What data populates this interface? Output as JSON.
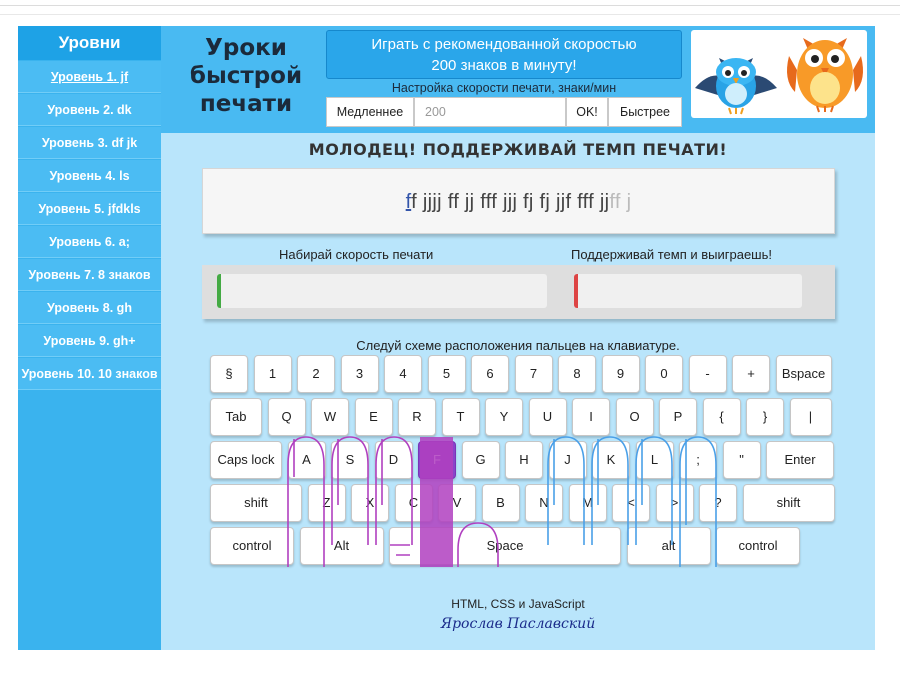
{
  "sidebar": {
    "title": "Уровни",
    "items": [
      {
        "label": "Уровень 1. jf",
        "active": true
      },
      {
        "label": "Уровень 2. dk"
      },
      {
        "label": "Уровень 3. df jk"
      },
      {
        "label": "Уровень 4. ls"
      },
      {
        "label": "Уровень 5. jfdkls"
      },
      {
        "label": "Уровень 6. a;"
      },
      {
        "label": "Уровень 7. 8 знаков"
      },
      {
        "label": "Уровень 8. gh"
      },
      {
        "label": "Уровень 9. gh+"
      },
      {
        "label": "Уровень 10. 10 знаков"
      }
    ]
  },
  "header": {
    "logo": "Уроки быстрой печати",
    "speed_button": "Играть с рекомендованной скоростью 200 знаков в минуту!",
    "speed_label": "Настройка скорости печати, знаки/мин",
    "slower": "Медленнее",
    "speed_value": "200",
    "ok": "OK!",
    "faster": "Быстрее"
  },
  "praise": "МОЛОДЕЦ! ПОДДЕРЖИВАЙ ТЕМП ПЕЧАТИ!",
  "exercise": {
    "current": "f",
    "rest": "f jjjj ff jj fff jjj fj fj jjf fff jj",
    "faded": "ff j"
  },
  "progress": {
    "left_label": "Набирай скорость печати",
    "right_label": "Поддерживай темп и выиграешь!",
    "left_fill": 0.01,
    "right_fill": 0.01
  },
  "keyboard": {
    "title": "Следуй схеме расположения пальцев на клавиатуре.",
    "highlight_key": "F",
    "rows": [
      [
        "§",
        "1",
        "2",
        "3",
        "4",
        "5",
        "6",
        "7",
        "8",
        "9",
        "0",
        "-",
        "+",
        "Bspace"
      ],
      [
        "Tab",
        "Q",
        "W",
        "E",
        "R",
        "T",
        "Y",
        "U",
        "I",
        "O",
        "P",
        "{",
        "}",
        "|"
      ],
      [
        "Caps lock",
        "A",
        "S",
        "D",
        "F",
        "G",
        "H",
        "J",
        "K",
        "L",
        ";",
        "\"",
        "Enter"
      ],
      [
        "shift",
        "Z",
        "X",
        "C",
        "V",
        "B",
        "N",
        "M",
        "<",
        ">",
        "?",
        "shift"
      ],
      [
        "control",
        "Alt",
        "Space",
        "alt",
        "control"
      ]
    ]
  },
  "footer": {
    "tech": "HTML, CSS и JavaScript",
    "author": "Ярослав Паславский"
  },
  "colors": {
    "sidebar": "#3ab3ee",
    "header": "#49baf2",
    "main_bg": "#b9e5fb",
    "highlight": "#8a44c9",
    "left_finger": "#b040c0",
    "right_finger": "#4aa0e8"
  }
}
